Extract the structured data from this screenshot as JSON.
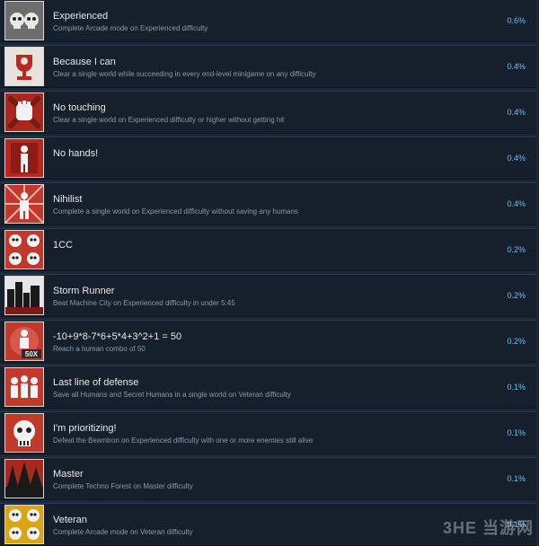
{
  "achievements": [
    {
      "icon": "skulls-icon",
      "title": "Experienced",
      "desc": "Complete Arcade mode on Experienced difficulty",
      "percent": "0.6%"
    },
    {
      "icon": "trophy-icon",
      "title": "Because I can",
      "desc": "Clear a single world while succeeding in every end-level minigame on any difficulty",
      "percent": "0.4%"
    },
    {
      "icon": "fist-icon",
      "title": "No touching",
      "desc": "Clear a single world on Experienced difficulty or higher without getting hit",
      "percent": "0.4%"
    },
    {
      "icon": "armless-figure-icon",
      "title": "No hands!",
      "desc": "",
      "percent": "0.4%"
    },
    {
      "icon": "figure-rays-icon",
      "title": "Nihilist",
      "desc": "Complete a single world on Experienced difficulty without saving any humans",
      "percent": "0.4%"
    },
    {
      "icon": "four-skulls-icon",
      "title": "1CC",
      "desc": "",
      "percent": "0.2%"
    },
    {
      "icon": "city-icon",
      "title": "Storm Runner",
      "desc": "Beat Machine City on Experienced difficulty in under 5:45",
      "percent": "0.2%"
    },
    {
      "icon": "combo-50-icon",
      "title": "-10+9*8-7*6+5*4+3^2+1 = 50",
      "desc": "Reach a human combo of 50",
      "percent": "0.2%"
    },
    {
      "icon": "humans-group-icon",
      "title": "Last line of defense",
      "desc": "Save all Humans and Secret Humans in a single world on Veteran difficulty",
      "percent": "0.1%"
    },
    {
      "icon": "robot-skull-icon",
      "title": "I'm prioritizing!",
      "desc": "Defeat the Beamtron on Experienced difficulty with one or more enemies still alive",
      "percent": "0.1%"
    },
    {
      "icon": "forest-icon",
      "title": "Master",
      "desc": "Complete Techno Forest on Master difficulty",
      "percent": "0.1%"
    },
    {
      "icon": "gold-skulls-icon",
      "title": "Veteran",
      "desc": "Complete Arcade mode on Veteran difficulty",
      "percent": "0.1%"
    }
  ],
  "watermark": "3HE 当游网",
  "colors": {
    "background": "#1b2838",
    "row": "#16202d",
    "percent": "#66c0f4",
    "icon_red": "#c0392b"
  }
}
